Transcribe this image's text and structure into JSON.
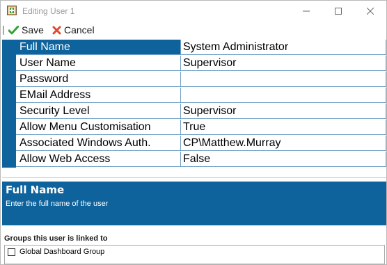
{
  "window": {
    "title": "Editing User 1"
  },
  "toolbar": {
    "save_label": "Save",
    "cancel_label": "Cancel"
  },
  "properties": [
    {
      "name": "Full Name",
      "value": "System Administrator"
    },
    {
      "name": "User Name",
      "value": "Supervisor"
    },
    {
      "name": "Password",
      "value": ""
    },
    {
      "name": "EMail Address",
      "value": ""
    },
    {
      "name": "Security Level",
      "value": "Supervisor"
    },
    {
      "name": "Allow Menu Customisation",
      "value": "True"
    },
    {
      "name": "Associated Windows Auth.",
      "value": "CP\\Matthew.Murray"
    },
    {
      "name": "Allow Web Access",
      "value": "False"
    }
  ],
  "description": {
    "title": "Full Name",
    "text": "Enter the full name of the user"
  },
  "groups": {
    "label": "Groups this user is linked to",
    "items": [
      {
        "label": "Global Dashboard Group",
        "checked": false
      }
    ]
  },
  "colors": {
    "accent": "#0e639c",
    "grid_line": "#6fa0c8"
  }
}
